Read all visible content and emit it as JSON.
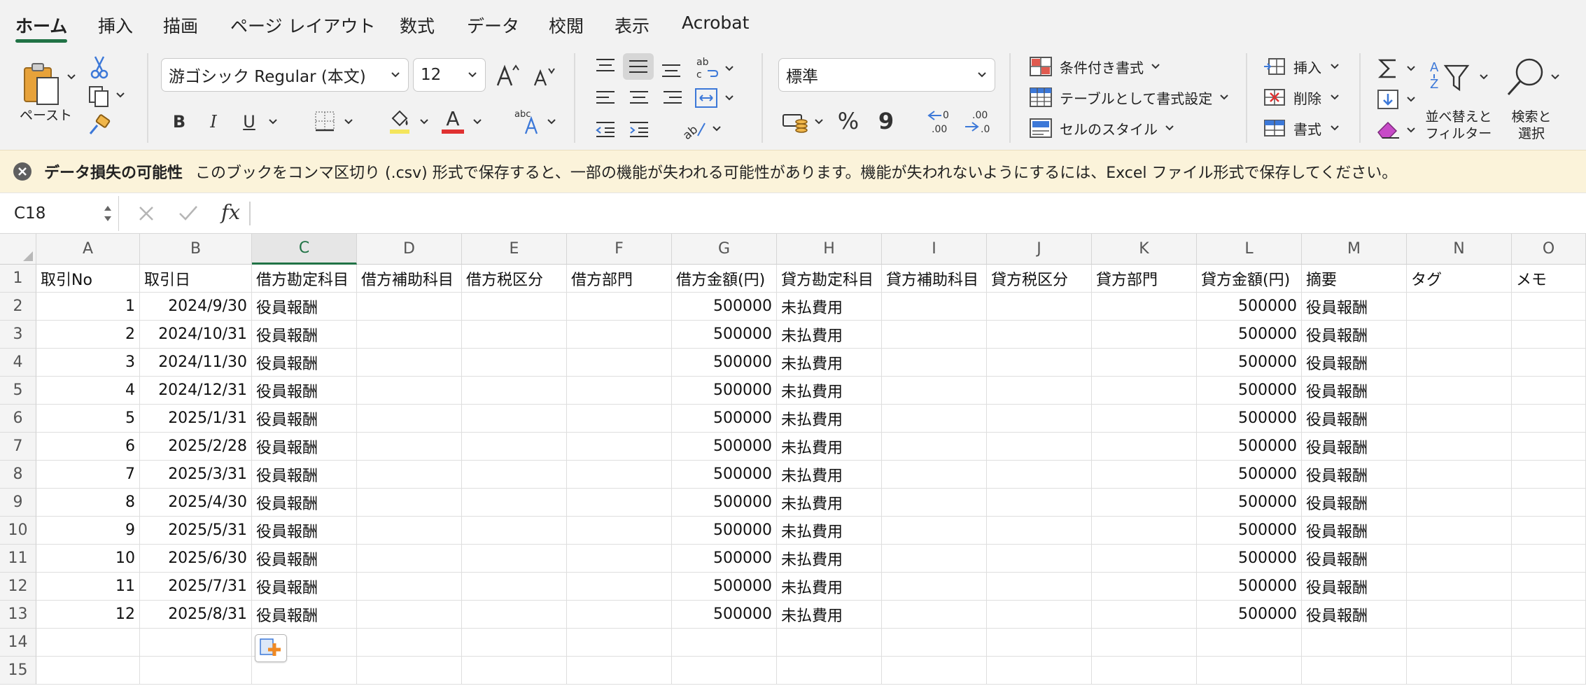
{
  "tabs": [
    "ホーム",
    "挿入",
    "描画",
    "ページ レイアウト",
    "数式",
    "データ",
    "校閲",
    "表示",
    "Acrobat"
  ],
  "ribbon": {
    "paste_label": "ペースト",
    "font_name": "游ゴシック Regular (本文)",
    "font_size": "12",
    "bold": "B",
    "italic": "I",
    "underline": "U",
    "font_color_glyph": "A",
    "number_format": "標準",
    "percent": "%",
    "comma": "9",
    "conditional_format": "条件付き書式",
    "format_as_table": "テーブルとして書式設定",
    "cell_styles": "セルのスタイル",
    "insert": "挿入",
    "delete": "削除",
    "format": "書式",
    "sort_filter_line1": "並べ替えと",
    "sort_filter_line2": "フィルター",
    "find_select_line1": "検索と",
    "find_select_line2": "選択",
    "accent_color": "#217346",
    "fill_color": "#f4e55c",
    "font_color": "#e03131"
  },
  "warning": {
    "title": "データ損失の可能性",
    "message": "このブックをコンマ区切り (.csv) 形式で保存すると、一部の機能が失われる可能性があります。機能が失われないようにするには、Excel ファイル形式で保存してください。"
  },
  "formula_bar": {
    "name_box": "C18",
    "fx": "fx",
    "content": ""
  },
  "sheet": {
    "columns": [
      "A",
      "B",
      "C",
      "D",
      "E",
      "F",
      "G",
      "H",
      "I",
      "J",
      "K",
      "L",
      "M",
      "N",
      "O"
    ],
    "selected_column": "C",
    "row_numbers": [
      "1",
      "2",
      "3",
      "4",
      "5",
      "6",
      "7",
      "8",
      "9",
      "10",
      "11",
      "12",
      "13",
      "14",
      "15"
    ],
    "header_row": [
      "取引No",
      "取引日",
      "借方勘定科目",
      "借方補助科目",
      "借方税区分",
      "借方部門",
      "借方金額(円)",
      "貸方勘定科目",
      "貸方補助科目",
      "貸方税区分",
      "貸方部門",
      "貸方金額(円)",
      "摘要",
      "タグ",
      "メモ"
    ],
    "rows": [
      [
        "1",
        "2024/9/30",
        "役員報酬",
        "",
        "",
        "",
        "500000",
        "未払費用",
        "",
        "",
        "",
        "500000",
        "役員報酬",
        "",
        ""
      ],
      [
        "2",
        "2024/10/31",
        "役員報酬",
        "",
        "",
        "",
        "500000",
        "未払費用",
        "",
        "",
        "",
        "500000",
        "役員報酬",
        "",
        ""
      ],
      [
        "3",
        "2024/11/30",
        "役員報酬",
        "",
        "",
        "",
        "500000",
        "未払費用",
        "",
        "",
        "",
        "500000",
        "役員報酬",
        "",
        ""
      ],
      [
        "4",
        "2024/12/31",
        "役員報酬",
        "",
        "",
        "",
        "500000",
        "未払費用",
        "",
        "",
        "",
        "500000",
        "役員報酬",
        "",
        ""
      ],
      [
        "5",
        "2025/1/31",
        "役員報酬",
        "",
        "",
        "",
        "500000",
        "未払費用",
        "",
        "",
        "",
        "500000",
        "役員報酬",
        "",
        ""
      ],
      [
        "6",
        "2025/2/28",
        "役員報酬",
        "",
        "",
        "",
        "500000",
        "未払費用",
        "",
        "",
        "",
        "500000",
        "役員報酬",
        "",
        ""
      ],
      [
        "7",
        "2025/3/31",
        "役員報酬",
        "",
        "",
        "",
        "500000",
        "未払費用",
        "",
        "",
        "",
        "500000",
        "役員報酬",
        "",
        ""
      ],
      [
        "8",
        "2025/4/30",
        "役員報酬",
        "",
        "",
        "",
        "500000",
        "未払費用",
        "",
        "",
        "",
        "500000",
        "役員報酬",
        "",
        ""
      ],
      [
        "9",
        "2025/5/31",
        "役員報酬",
        "",
        "",
        "",
        "500000",
        "未払費用",
        "",
        "",
        "",
        "500000",
        "役員報酬",
        "",
        ""
      ],
      [
        "10",
        "2025/6/30",
        "役員報酬",
        "",
        "",
        "",
        "500000",
        "未払費用",
        "",
        "",
        "",
        "500000",
        "役員報酬",
        "",
        ""
      ],
      [
        "11",
        "2025/7/31",
        "役員報酬",
        "",
        "",
        "",
        "500000",
        "未払費用",
        "",
        "",
        "",
        "500000",
        "役員報酬",
        "",
        ""
      ],
      [
        "12",
        "2025/8/31",
        "役員報酬",
        "",
        "",
        "",
        "500000",
        "未払費用",
        "",
        "",
        "",
        "500000",
        "役員報酬",
        "",
        ""
      ],
      [
        "",
        "",
        "",
        "",
        "",
        "",
        "",
        "",
        "",
        "",
        "",
        "",
        "",
        "",
        ""
      ],
      [
        "",
        "",
        "",
        "",
        "",
        "",
        "",
        "",
        "",
        "",
        "",
        "",
        "",
        "",
        ""
      ]
    ]
  }
}
